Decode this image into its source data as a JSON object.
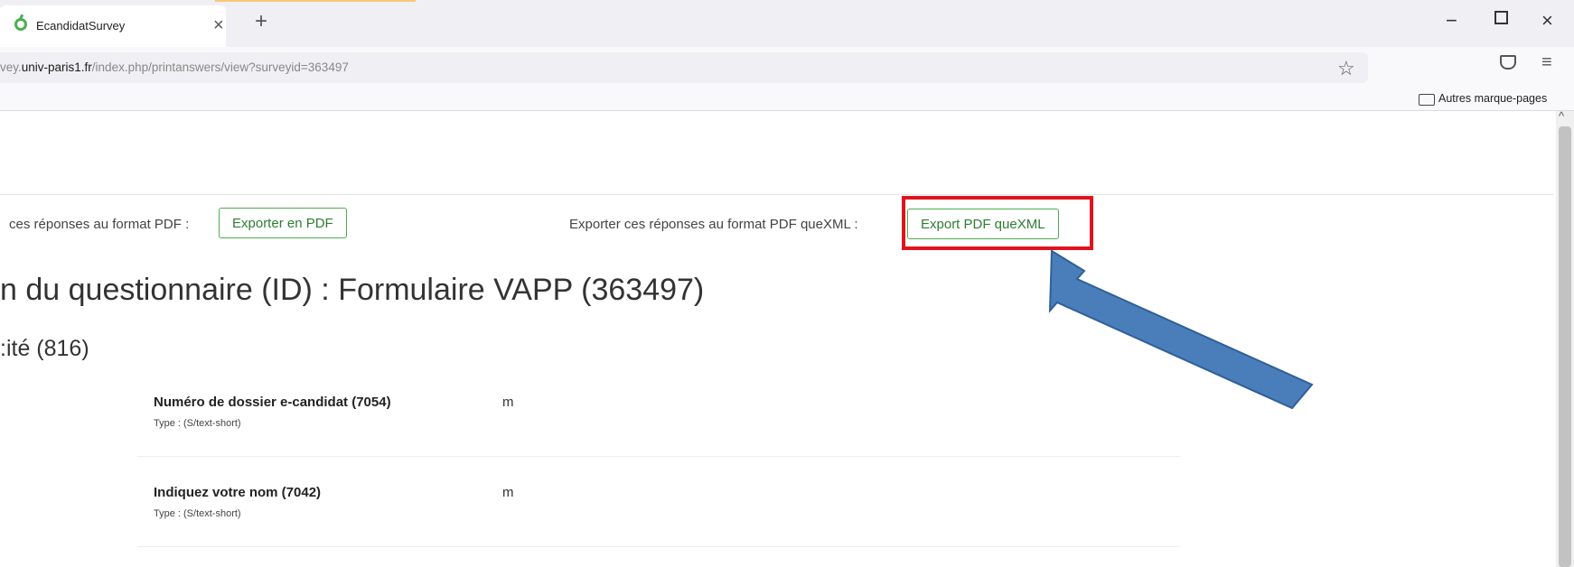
{
  "browser": {
    "tab_title": "EcandidatSurvey",
    "tab_close": "×",
    "new_tab": "+",
    "window_minimize": "−",
    "window_close": "×",
    "url_prefix": "vey.",
    "url_domain": "univ-paris1.fr",
    "url_path": "/index.php/printanswers/view?surveyid=363497",
    "star_icon": "☆",
    "menu_icon": "≡",
    "bookmarks_folder_label": "Autres marque-pages",
    "scroll_up": "^"
  },
  "page": {
    "export_pdf_label": "ces réponses au format PDF :",
    "export_pdf_button": "Exporter en PDF",
    "export_quexml_label": "Exporter ces réponses au format PDF queXML :",
    "export_quexml_button": "Export PDF queXML",
    "survey_title": "n du questionnaire (ID) : Formulaire VAPP (363497)",
    "group_title": ":ité (816)",
    "questions": [
      {
        "label": "Numéro de dossier e-candidat (7054)",
        "type": "Type : (S/text-short)",
        "answer": "m"
      },
      {
        "label": "Indiquez votre nom (7042)",
        "type": "Type : (S/text-short)",
        "answer": "m"
      }
    ]
  },
  "annotations": {
    "highlight_color": "#e0141e",
    "arrow_color": "#4a7ebb"
  },
  "colors": {
    "button_border": "#4cae4c",
    "button_text": "#2e7d32"
  }
}
